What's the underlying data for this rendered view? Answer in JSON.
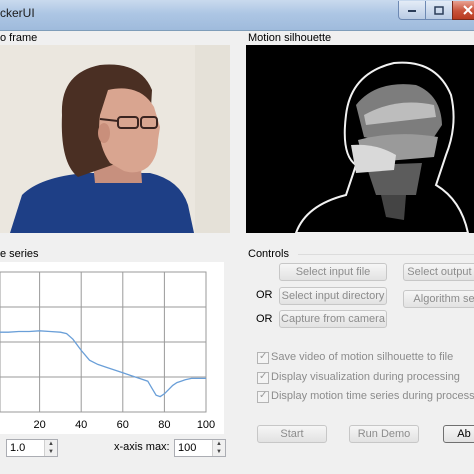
{
  "window": {
    "title": "ckerUI",
    "controls": [
      "minimize-icon",
      "maximize-icon",
      "close-icon"
    ]
  },
  "video_panel": {
    "label": "o frame"
  },
  "silhouette_panel": {
    "label": "Motion silhouette"
  },
  "timeseries_panel": {
    "label": "e series"
  },
  "controls_panel": {
    "label": "Controls",
    "buttons": {
      "select_input_file": "Select input file",
      "select_output_dir": "Select output d",
      "select_input_dir": "Select input directory",
      "algorithm_settings": "Algorithm se",
      "capture_camera": "Capture from camera",
      "start": "Start",
      "run_demo": "Run Demo",
      "about": "Ab"
    },
    "or_labels": [
      "OR",
      "OR"
    ],
    "checkboxes": [
      {
        "label": "Save video of motion silhouette to file",
        "checked": true,
        "enabled": false
      },
      {
        "label": "Display visualization during processing",
        "checked": true,
        "enabled": false
      },
      {
        "label": "Display motion time series during processing",
        "checked": true,
        "enabled": false
      }
    ]
  },
  "axis_controls": {
    "x_min_value": "1.0",
    "x_max_label": "x-axis max:",
    "x_max_value": "100"
  },
  "chart_data": {
    "type": "line",
    "xlim": [
      0,
      100
    ],
    "ylim": [
      0,
      1
    ],
    "xticks": [
      "20",
      "40",
      "60",
      "80",
      "100"
    ],
    "grid": true,
    "color": "#6a9fd8",
    "x": [
      0,
      5,
      10,
      15,
      20,
      25,
      30,
      33,
      36,
      40,
      44,
      48,
      52,
      56,
      60,
      64,
      68,
      72,
      74,
      76,
      78,
      80,
      82,
      84,
      86,
      88,
      90,
      93,
      96,
      100
    ],
    "y": [
      0.57,
      0.57,
      0.575,
      0.575,
      0.58,
      0.575,
      0.57,
      0.56,
      0.52,
      0.44,
      0.37,
      0.34,
      0.32,
      0.3,
      0.28,
      0.26,
      0.24,
      0.22,
      0.17,
      0.12,
      0.11,
      0.13,
      0.16,
      0.19,
      0.21,
      0.22,
      0.23,
      0.24,
      0.24,
      0.24
    ]
  }
}
